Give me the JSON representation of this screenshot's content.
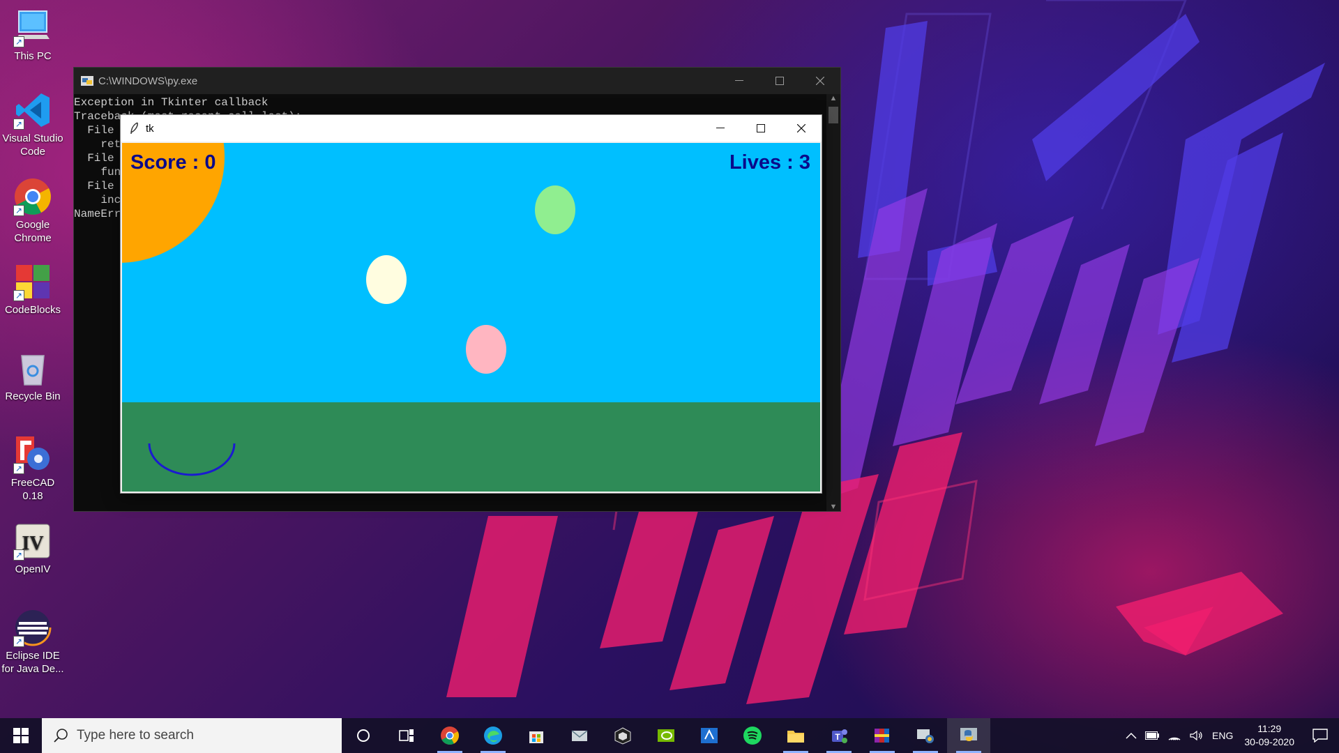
{
  "desktop": {
    "icons": [
      {
        "label": "This PC",
        "icon": "computer-icon"
      },
      {
        "label": "Visual Studio Code",
        "icon": "vscode-icon"
      },
      {
        "label": "Google Chrome",
        "icon": "chrome-icon"
      },
      {
        "label": "CodeBlocks",
        "icon": "codeblocks-icon"
      },
      {
        "label": "Recycle Bin",
        "icon": "recycle-bin-icon"
      },
      {
        "label": "FreeCAD 0.18",
        "icon": "freecad-icon"
      },
      {
        "label": "OpenIV",
        "icon": "openiv-icon"
      },
      {
        "label": "Eclipse IDE for Java De...",
        "icon": "eclipse-icon"
      }
    ]
  },
  "console": {
    "title": "C:\\WINDOWS\\py.exe",
    "lines": [
      "Exception in Tkinter callback",
      "Traceback (most recent call last):",
      "  File \"",
      "    retu",
      "  File \"",
      "    func",
      "  File \"",
      "    incr",
      "NameErro"
    ]
  },
  "tk_window": {
    "title": "tk",
    "score_text": "Score : 0",
    "lives_text": "Lives : 3",
    "colors": {
      "sky": "#00bfff",
      "ground": "#2e8b57",
      "sun": "#ffa500",
      "text": "#0a0a8a",
      "basket": "#1a1ad0",
      "eggs": [
        "#90ee90",
        "#fffde0",
        "#ffb6c1"
      ]
    }
  },
  "taskbar": {
    "search_placeholder": "Type here to search",
    "apps": [
      "cortana-icon",
      "task-view-icon",
      "chrome-icon",
      "edge-icon",
      "store-icon",
      "mail-icon",
      "unity-icon",
      "nvidia-icon",
      "remote-icon",
      "spotify-icon",
      "explorer-icon",
      "teams-icon",
      "winrar-icon",
      "network-app-icon",
      "python-icon"
    ],
    "language": "ENG",
    "time": "11:29",
    "date": "30-09-2020"
  }
}
